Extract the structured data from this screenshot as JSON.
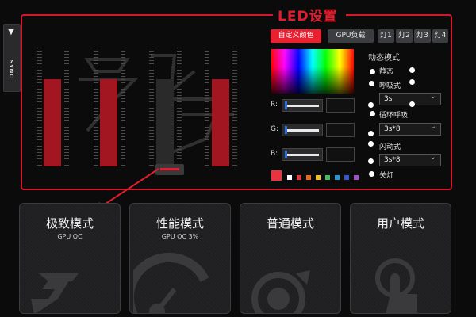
{
  "side_tab": {
    "label": "SYNC"
  },
  "led": {
    "title": "LED设置",
    "buttons": [
      "自定义颜色",
      "GPU负载"
    ],
    "light_tabs": [
      "灯1",
      "灯2",
      "灯3",
      "灯4"
    ]
  },
  "rgb": {
    "r_label": "R:",
    "g_label": "G:",
    "b_label": "B:"
  },
  "palette": [
    "#ffffff",
    "#e8343f",
    "#f06a1a",
    "#f3c21a",
    "#3ec15c",
    "#1e9bd7",
    "#2e58d6",
    "#a24fcf"
  ],
  "dynamic": {
    "title": "动态模式",
    "modes": [
      {
        "label": "静态"
      },
      {
        "label": "呼吸式",
        "select": "3s"
      },
      {
        "label": "循环呼吸",
        "select": "3s*8"
      },
      {
        "label": "闪动式",
        "select": "3s*8"
      },
      {
        "label": "关灯"
      }
    ]
  },
  "cards": [
    {
      "title": "极致模式",
      "sub": "GPU OC"
    },
    {
      "title": "性能模式",
      "sub": "GPU OC 3%"
    },
    {
      "title": "普通模式",
      "sub": ""
    },
    {
      "title": "用户模式",
      "sub": ""
    }
  ],
  "colors": {
    "accent_red": "#e01e2e",
    "bar_red": "#a11620",
    "panel_bg": "#0b0b0c"
  }
}
